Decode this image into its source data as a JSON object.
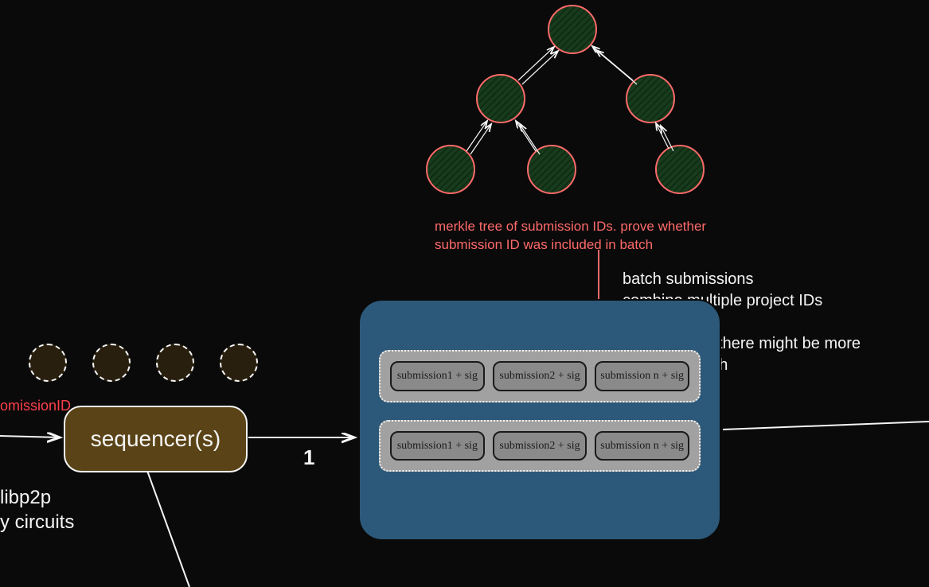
{
  "merkle_caption_line1": "merkle tree of submission IDs. prove whether",
  "merkle_caption_line2": "submission ID was included in batch",
  "batch_caption_line1": "batch submissions",
  "batch_caption_line2": "combine multiple project IDs",
  "batch_caption_line3": "per epoch ID there might be more",
  "batch_caption_line4": "than one batch",
  "sequencer_label": "sequencer(s)",
  "submission_id_label": "omissionID",
  "libp2p_line1": "libp2p",
  "libp2p_line2": "y circuits",
  "edge_label": "1",
  "batch": {
    "row1": {
      "s1": "submission1 + sig",
      "s2": "submission2 + sig",
      "s3": "submission n + sig"
    },
    "row2": {
      "s1": "submission1 + sig",
      "s2": "submission2 + sig",
      "s3": "submission n + sig"
    }
  }
}
